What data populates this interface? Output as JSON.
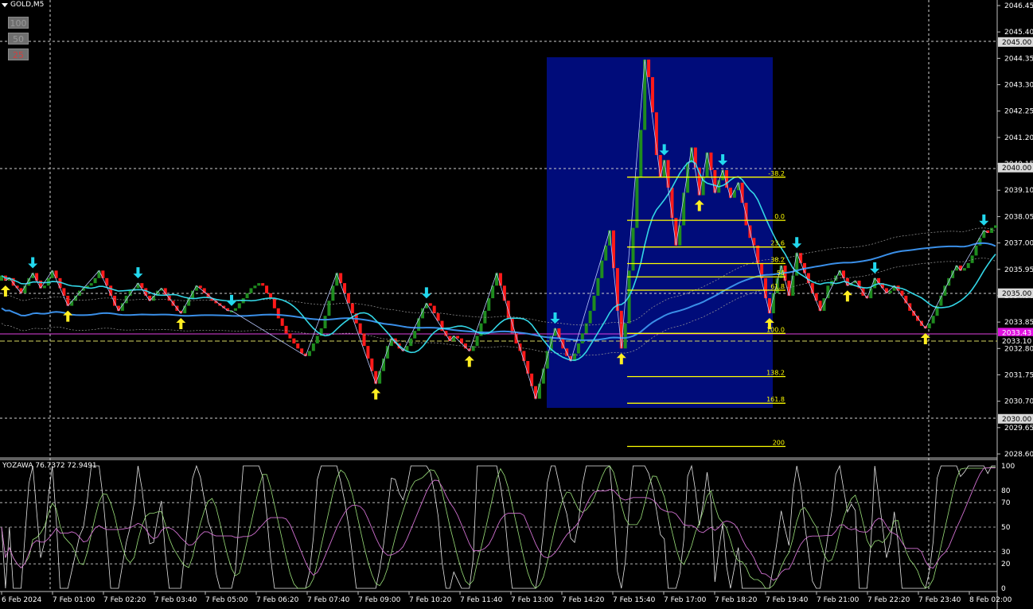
{
  "chart_window": {
    "symbol_label": "GOLD,M5",
    "zoom_buttons": [
      "100",
      "50",
      "25"
    ],
    "active_zoom": "25",
    "subwindow_label": "YOZAWA 76.7372 72.9491"
  },
  "colors": {
    "background": "#000000",
    "bull_bar": "#1f8c1f",
    "bear_bar": "#ff1a1a",
    "ma_fast": "#33d6e6",
    "ma_slow": "#3a8fe8",
    "ma_mid": "#e04a9a",
    "fib_line": "#ffff00",
    "fib_box": "#000c7a",
    "arrow_up": "#ffee22",
    "arrow_down": "#22d8ee",
    "grid": "#cfcfcf"
  },
  "chart_data": [
    {
      "type": "candlestick",
      "x_ticks": [
        "6 Feb 2024",
        "7 Feb 01:00",
        "7 Feb 02:20",
        "7 Feb 03:40",
        "7 Feb 05:00",
        "7 Feb 06:20",
        "7 Feb 07:40",
        "7 Feb 09:00",
        "7 Feb 10:20",
        "7 Feb 11:40",
        "7 Feb 13:00",
        "7 Feb 14:20",
        "7 Feb 15:40",
        "7 Feb 17:00",
        "7 Feb 18:20",
        "7 Feb 19:40",
        "7 Feb 21:00",
        "7 Feb 22:20",
        "7 Feb 23:40",
        "8 Feb 02:00"
      ],
      "y_ticks": [
        "2046.45",
        "2045.40",
        "2044.35",
        "2043.30",
        "2042.25",
        "2041.20",
        "2040.15",
        "2039.10",
        "2038.05",
        "2037.00",
        "2035.95",
        "2034.90",
        "2033.85",
        "2032.80",
        "2031.75",
        "2030.70",
        "2029.65",
        "2028.60"
      ],
      "ylim": [
        2028.6,
        2046.45
      ],
      "price_tags": [
        {
          "value": "2045.00",
          "kind": "grid"
        },
        {
          "value": "2040.00",
          "kind": "grid"
        },
        {
          "value": "2035.00",
          "kind": "grid"
        },
        {
          "value": "2033.43",
          "kind": "ma"
        },
        {
          "value": "2033.10",
          "kind": "current"
        },
        {
          "value": "2030.00",
          "kind": "grid"
        }
      ],
      "close_series": [
        2035.7,
        2035.5,
        2035.6,
        2035.3,
        2035.2,
        2035.0,
        2035.3,
        2035.6,
        2035.8,
        2035.5,
        2035.2,
        2035.3,
        2035.6,
        2035.9,
        2035.6,
        2035.2,
        2034.9,
        2034.5,
        2034.7,
        2034.9,
        2035.1,
        2035.2,
        2035.3,
        2035.4,
        2035.6,
        2035.9,
        2035.6,
        2035.3,
        2034.9,
        2034.5,
        2034.3,
        2034.6,
        2034.9,
        2035.1,
        2035.2,
        2035.4,
        2035.2,
        2034.9,
        2034.7,
        2034.9,
        2035.1,
        2035.2,
        2034.9,
        2034.7,
        2034.5,
        2034.3,
        2034.2,
        2034.5,
        2034.8,
        2035.1,
        2035.3,
        2035.2,
        2035.0,
        2034.8,
        2034.7,
        2034.6,
        2034.5,
        2034.4,
        2034.3,
        2034.3,
        2034.4,
        2034.6,
        2034.8,
        2035.0,
        2035.2,
        2035.3,
        2035.4,
        2035.3,
        2035.0,
        2034.8,
        2034.4,
        2034.0,
        2033.7,
        2033.4,
        2033.2,
        2033.0,
        2032.8,
        2032.6,
        2032.5,
        2032.7,
        2033.0,
        2033.3,
        2033.6,
        2034.1,
        2034.7,
        2035.3,
        2035.8,
        2035.4,
        2035.0,
        2034.6,
        2034.2,
        2033.8,
        2033.4,
        2032.9,
        2032.4,
        2031.9,
        2031.4,
        2031.9,
        2032.4,
        2032.9,
        2033.2,
        2033.0,
        2032.8,
        2032.7,
        2032.9,
        2033.2,
        2033.5,
        2034.0,
        2034.4,
        2034.6,
        2034.5,
        2034.2,
        2033.9,
        2033.5,
        2033.3,
        2033.1,
        2033.3,
        2033.2,
        2033.0,
        2032.8,
        2032.7,
        2032.9,
        2033.3,
        2033.8,
        2034.3,
        2034.8,
        2035.3,
        2035.8,
        2035.3,
        2034.7,
        2034.0,
        2033.4,
        2033.0,
        2032.7,
        2032.3,
        2031.8,
        2031.3,
        2030.8,
        2031.4,
        2032.0,
        2032.7,
        2033.3,
        2033.6,
        2033.2,
        2032.8,
        2032.5,
        2032.3,
        2032.6,
        2033.0,
        2033.4,
        2033.8,
        2034.3,
        2034.9,
        2035.6,
        2036.3,
        2036.9,
        2037.5,
        2036.0,
        2034.3,
        2032.8,
        2033.8,
        2035.9,
        2037.6,
        2039.6,
        2041.5,
        2044.3,
        2043.6,
        2042.2,
        2040.5,
        2039.6,
        2040.3,
        2039.2,
        2038.0,
        2036.9,
        2037.7,
        2039.0,
        2040.2,
        2040.8,
        2040.0,
        2038.9,
        2039.6,
        2040.6,
        2039.9,
        2039.0,
        2039.5,
        2039.9,
        2039.2,
        2038.8,
        2039.1,
        2039.4,
        2038.6,
        2037.7,
        2037.2,
        2036.9,
        2036.2,
        2035.6,
        2034.8,
        2034.2,
        2035.0,
        2035.6,
        2036.1,
        2035.5,
        2034.9,
        2035.7,
        2036.6,
        2036.2,
        2035.8,
        2035.4,
        2035.0,
        2034.7,
        2034.3,
        2034.8,
        2035.3,
        2035.5,
        2035.7,
        2035.9,
        2035.6,
        2035.3,
        2035.4,
        2035.5,
        2035.2,
        2034.9,
        2034.8,
        2035.2,
        2035.6,
        2035.4,
        2035.2,
        2035.0,
        2035.1,
        2035.3,
        2035.1,
        2034.9,
        2034.6,
        2034.3,
        2034.1,
        2033.9,
        2033.7,
        2033.6,
        2033.8,
        2034.1,
        2034.5,
        2034.9,
        2035.3,
        2035.6,
        2035.9,
        2036.1,
        2035.9,
        2036.0,
        2036.2,
        2036.5,
        2036.9,
        2037.2,
        2037.5,
        2037.4,
        2037.6,
        2037.7
      ]
    },
    {
      "type": "line",
      "name": "fibonacci_levels",
      "levels": [
        "-38.2",
        "0.0",
        "23.6",
        "38.2",
        "50",
        "61.8",
        "100.0",
        "138.2",
        "161.8",
        "200"
      ],
      "swing_high": 2037.9,
      "swing_low": 2033.4
    },
    {
      "type": "line",
      "name": "YOZAWA",
      "values_label": "76.7372 72.9491",
      "y_ticks": [
        "100",
        "80",
        "70",
        "50",
        "30",
        "20",
        "0"
      ],
      "ylim": [
        0,
        100
      ]
    }
  ]
}
